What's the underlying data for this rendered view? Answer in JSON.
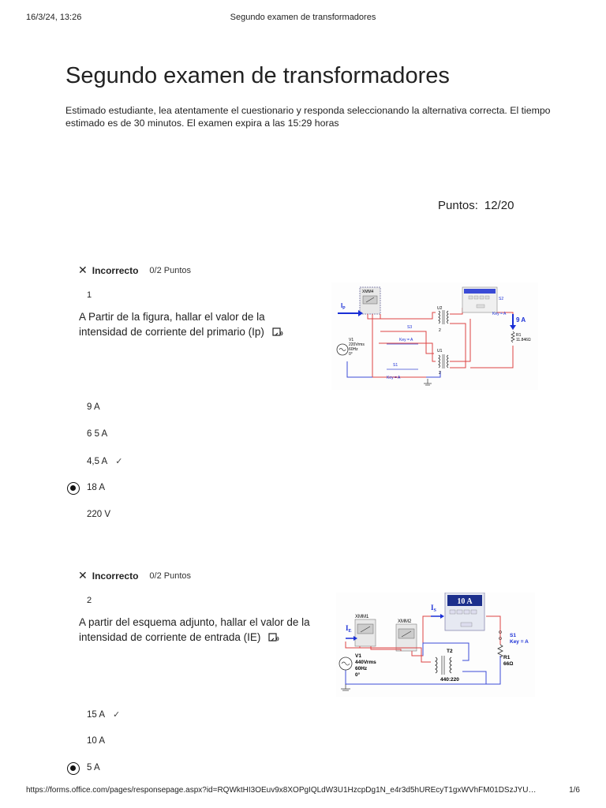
{
  "print": {
    "date": "16/3/24, 13:26",
    "doc_title": "Segundo examen de transformadores",
    "url": "https://forms.office.com/pages/responsepage.aspx?id=RQWktHI3OEuv9x8XOPgIQLdW3U1HzcpDg1N_e4r3d5hUREcyT1gxWVhFM01DSzJYU…",
    "page": "1/6"
  },
  "exam": {
    "title": "Segundo examen de transformadores",
    "description": "Estimado estudiante, lea atentamente el cuestionario y responda seleccionando la alternativa correcta.  El tiempo estimado es de 30 minutos. El examen expira a las 15:29 horas",
    "score_label": "Puntos:",
    "score_value": "12/20"
  },
  "questions": [
    {
      "status": "Incorrecto",
      "points": "0/2 Puntos",
      "number": "1",
      "text": "A Partir de la figura, hallar el valor de la intensidad de corriente del primario (Ip)",
      "options": [
        {
          "label": "9 A",
          "selected": false,
          "correct": false
        },
        {
          "label": "6 5 A",
          "selected": false,
          "correct": false
        },
        {
          "label": "4,5 A",
          "selected": false,
          "correct": true
        },
        {
          "label": "18 A",
          "selected": true,
          "correct": false
        },
        {
          "label": "220 V",
          "selected": false,
          "correct": false
        }
      ],
      "figure": {
        "meter": "XMM4",
        "ip_label": "I",
        "ip_sub": "P",
        "u2": "U2",
        "u1": "U1",
        "s1": "S1",
        "s2": "S2",
        "s3": "S3",
        "key": "Key = A",
        "v1": "V1",
        "v1_volts": "220Vrms",
        "v1_freq": "60Hz",
        "v1_phase": "0°",
        "r1": "R1",
        "r1_value": "11.846Ω",
        "current": "9 A",
        "winding": "2"
      }
    },
    {
      "status": "Incorrecto",
      "points": "0/2 Puntos",
      "number": "2",
      "text": "A partir del esquema adjunto, hallar el valor de la intensidad de corriente de entrada (IE)",
      "options": [
        {
          "label": "15 A",
          "selected": false,
          "correct": true
        },
        {
          "label": "10 A",
          "selected": false,
          "correct": false
        },
        {
          "label": "5 A",
          "selected": true,
          "correct": false
        }
      ],
      "figure": {
        "meter1": "XMM1",
        "meter2": "XMM2",
        "display": "10 A",
        "is_label": "I",
        "is_sub": "S",
        "ie_label": "I",
        "ie_sub": "E",
        "s1": "S1",
        "key": "Key = A",
        "t2": "T2",
        "ratio": "440:220",
        "v1": "V1",
        "v1_volts": "440Vrms",
        "v1_freq": "60Hz",
        "v1_phase": "0°",
        "r1": "R1",
        "r1_value": "66Ω"
      }
    }
  ]
}
